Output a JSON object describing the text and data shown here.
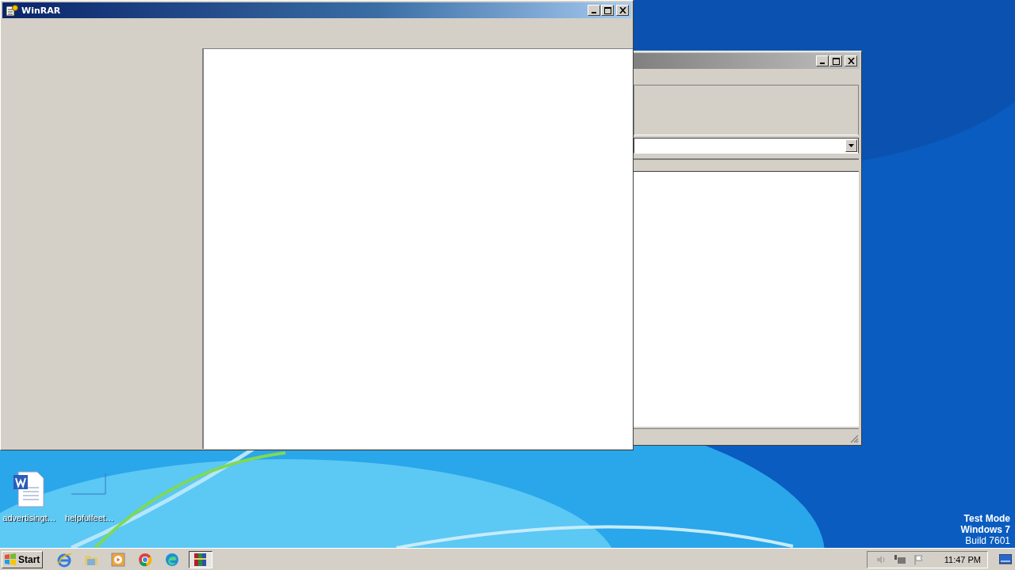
{
  "main_window": {
    "title": "WinRAR"
  },
  "desktop_icons": [
    {
      "label": "advertisingt…",
      "kind": "document"
    },
    {
      "label": "helpfulfeet…",
      "kind": "blank"
    }
  ],
  "taskbar": {
    "start": "Start",
    "apps": [
      {
        "kind": "ie",
        "selected": false
      },
      {
        "kind": "folder",
        "selected": false
      },
      {
        "kind": "media",
        "selected": false
      },
      {
        "kind": "chrome",
        "selected": false
      },
      {
        "kind": "edge",
        "selected": false
      },
      {
        "kind": "winrar",
        "selected": true
      }
    ],
    "clock": "11:47 PM"
  },
  "system_notice": [
    "Test Mode",
    "Windows 7",
    "Build 7601"
  ]
}
